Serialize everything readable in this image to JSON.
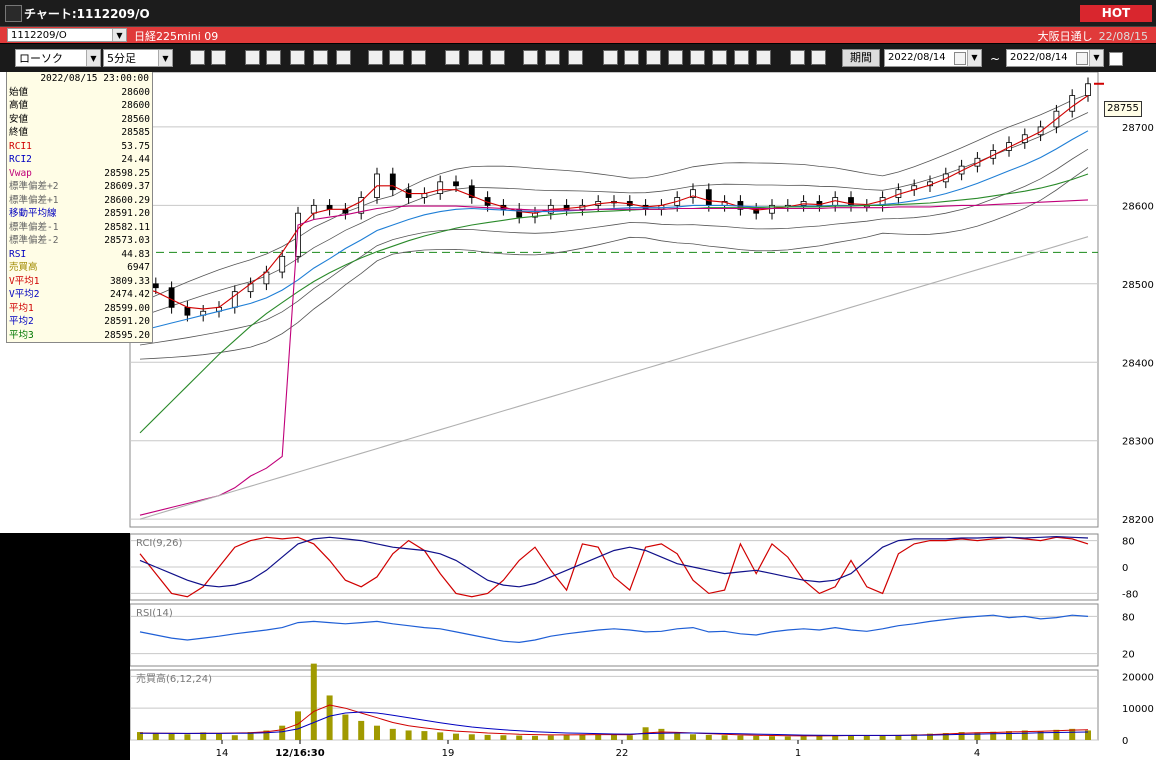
{
  "window": {
    "title": "チャート:1112209/O",
    "hot_label": "HOT"
  },
  "infobar": {
    "symbol": "1112209/O",
    "instrument": "日経225mini 09",
    "session": "大阪日通し",
    "date": "22/08/15"
  },
  "toolbar": {
    "chart_type": "ローソク",
    "interval": "5分足",
    "buttons": [
      "zoom",
      "crosshair",
      "drawing",
      "search",
      "period",
      "rci",
      "info",
      "pen",
      "select",
      "redo",
      "candle",
      "bar",
      "all",
      "settings",
      "tool",
      "color",
      "vwap",
      "ma",
      "bb",
      "vwma",
      "hl",
      "atr",
      "pa",
      "pvt",
      "log",
      "export"
    ],
    "period_label": "期間",
    "date_from": "2022/08/14",
    "date_to": "2022/08/14",
    "range_sep": "~"
  },
  "info_panel": {
    "timestamp": "2022/08/15  23:00:00",
    "rows": [
      {
        "label": "始値",
        "value": "28600",
        "color": "#000000"
      },
      {
        "label": "高値",
        "value": "28600",
        "color": "#000000"
      },
      {
        "label": "安値",
        "value": "28560",
        "color": "#000000"
      },
      {
        "label": "終値",
        "value": "28585",
        "color": "#000000"
      },
      {
        "label": "RCI1",
        "value": "53.75",
        "color": "#d00000"
      },
      {
        "label": "RCI2",
        "value": "24.44",
        "color": "#0000c0"
      },
      {
        "label": "Vwap",
        "value": "28598.25",
        "color": "#c0007a"
      },
      {
        "label": "標準偏差+2",
        "value": "28609.37",
        "color": "#666666"
      },
      {
        "label": "標準偏差+1",
        "value": "28600.29",
        "color": "#666666"
      },
      {
        "label": "移動平均線",
        "value": "28591.20",
        "color": "#0000c0"
      },
      {
        "label": "標準偏差-1",
        "value": "28582.11",
        "color": "#666666"
      },
      {
        "label": "標準偏差-2",
        "value": "28573.03",
        "color": "#666666"
      },
      {
        "label": "RSI",
        "value": "44.83",
        "color": "#0000c0"
      },
      {
        "label": "売買高",
        "value": "6947",
        "color": "#a08a00"
      },
      {
        "label": "V平均1",
        "value": "3809.33",
        "color": "#d00000"
      },
      {
        "label": "V平均2",
        "value": "2474.42",
        "color": "#0000c0"
      },
      {
        "label": "平均1",
        "value": "28599.00",
        "color": "#d00000"
      },
      {
        "label": "平均2",
        "value": "28591.20",
        "color": "#0000c0"
      },
      {
        "label": "平均3",
        "value": "28595.20",
        "color": "#007700"
      }
    ]
  },
  "chart_data": [
    {
      "type": "line",
      "title": "足",
      "yticks": [
        28200,
        28300,
        28400,
        28500,
        28600,
        28700
      ],
      "ylim": [
        28190,
        28770
      ],
      "current_price": "28755",
      "reference_price": 28540,
      "xticks": [
        "14",
        "12/16:30",
        "19",
        "22",
        "1",
        "4"
      ],
      "series": [
        {
          "key": "close",
          "color": "#000000",
          "values": [
            28500,
            28495,
            28470,
            28460,
            28465,
            28470,
            28490,
            28500,
            28515,
            28535,
            28590,
            28600,
            28595,
            28590,
            28610,
            28640,
            28620,
            28610,
            28615,
            28630,
            28625,
            28610,
            28600,
            28595,
            28585,
            28590,
            28600,
            28595,
            28600,
            28605,
            28605,
            28600,
            28595,
            28600,
            28610,
            28620,
            28600,
            28605,
            28595,
            28590,
            28600,
            28600,
            28605,
            28600,
            28610,
            28600,
            28600,
            28610,
            28620,
            28625,
            28630,
            28640,
            28650,
            28660,
            28670,
            28680,
            28690,
            28700,
            28720,
            28740,
            28755
          ]
        },
        {
          "key": "ma_fast",
          "color": "#d00000",
          "values": [
            28495,
            28490,
            28480,
            28470,
            28468,
            28470,
            28485,
            28500,
            28515,
            28540,
            28570,
            28590,
            28595,
            28595,
            28605,
            28625,
            28625,
            28615,
            28615,
            28620,
            28620,
            28612,
            28604,
            28598,
            28592,
            28590,
            28595,
            28596,
            28598,
            28602,
            28604,
            28602,
            28598,
            28600,
            28605,
            28612,
            28606,
            28604,
            28598,
            28594,
            28596,
            28598,
            28602,
            28601,
            28606,
            28602,
            28601,
            28606,
            28614,
            28620,
            28626,
            28634,
            28644,
            28654,
            28664,
            28674,
            28684,
            28694,
            28710,
            28726,
            28740
          ]
        },
        {
          "key": "ma_mid",
          "color": "#1f7fd6",
          "values": [
            28440,
            28445,
            28450,
            28455,
            28460,
            28465,
            28470,
            28475,
            28482,
            28492,
            28505,
            28520,
            28532,
            28545,
            28556,
            28568,
            28575,
            28582,
            28588,
            28592,
            28595,
            28596,
            28595,
            28594,
            28593,
            28592,
            28592,
            28593,
            28594,
            28595,
            28596,
            28597,
            28597,
            28597,
            28598,
            28600,
            28600,
            28600,
            28599,
            28598,
            28598,
            28598,
            28599,
            28599,
            28600,
            28600,
            28600,
            28601,
            28603,
            28606,
            28610,
            28615,
            28621,
            28628,
            28636,
            28644,
            28652,
            28661,
            28672,
            28684,
            28695
          ]
        },
        {
          "key": "ma_slow",
          "color": "#2a8a2a",
          "values": [
            28310,
            28330,
            28350,
            28370,
            28390,
            28410,
            28428,
            28446,
            28462,
            28476,
            28490,
            28503,
            28514,
            28524,
            28533,
            28541,
            28548,
            28555,
            28561,
            28566,
            28571,
            28575,
            28578,
            28581,
            28584,
            28586,
            28588,
            28590,
            28591,
            28592,
            28593,
            28594,
            28595,
            28595,
            28596,
            28596,
            28597,
            28597,
            28597,
            28597,
            28598,
            28598,
            28598,
            28598,
            28599,
            28599,
            28600,
            28600,
            28601,
            28602,
            28603,
            28605,
            28607,
            28609,
            28612,
            28615,
            28618,
            28622,
            28627,
            28633,
            28640
          ]
        },
        {
          "key": "vwap",
          "color": "#c0007a",
          "values": [
            28205,
            28210,
            28215,
            28220,
            28225,
            28230,
            28240,
            28255,
            28265,
            28280,
            28575,
            28582,
            28585,
            28588,
            28592,
            28596,
            28598,
            28599,
            28599,
            28599,
            28599,
            28598,
            28597,
            28596,
            28595,
            28594,
            28594,
            28594,
            28594,
            28595,
            28595,
            28595,
            28595,
            28595,
            28596,
            28596,
            28596,
            28596,
            28596,
            28596,
            28596,
            28596,
            28596,
            28596,
            28597,
            28597,
            28597,
            28597,
            28598,
            28598,
            28598,
            28599,
            28600,
            28600,
            28601,
            28602,
            28603,
            28604,
            28605,
            28606,
            28607
          ]
        },
        {
          "key": "trend",
          "color": "#b0b0b0",
          "values": [
            28200,
            28206,
            28212,
            28218,
            28224,
            28230,
            28236,
            28242,
            28248,
            28254,
            28260,
            28266,
            28272,
            28278,
            28284,
            28290,
            28296,
            28302,
            28308,
            28314,
            28320,
            28326,
            28332,
            28338,
            28344,
            28350,
            28356,
            28362,
            28368,
            28374,
            28380,
            28386,
            28392,
            28398,
            28404,
            28410,
            28416,
            28422,
            28428,
            28434,
            28440,
            28446,
            28452,
            28458,
            28464,
            28470,
            28476,
            28482,
            28488,
            28494,
            28500,
            28506,
            28512,
            28518,
            28524,
            28530,
            28536,
            28542,
            28548,
            28554,
            28560
          ]
        }
      ]
    },
    {
      "type": "line",
      "title": "RCI(9,26)",
      "yticks": [
        80,
        0,
        -80
      ],
      "ylim": [
        -100,
        100
      ],
      "series": [
        {
          "key": "rci_fast",
          "color": "#d00000",
          "values": [
            40,
            -20,
            -80,
            -90,
            -60,
            0,
            60,
            80,
            90,
            85,
            90,
            70,
            20,
            -40,
            -60,
            -30,
            40,
            80,
            50,
            -20,
            -80,
            -90,
            -80,
            -40,
            20,
            60,
            -10,
            -70,
            70,
            60,
            -30,
            -70,
            60,
            70,
            40,
            -40,
            -80,
            -70,
            70,
            -20,
            70,
            30,
            -40,
            -80,
            -60,
            20,
            -60,
            -80,
            40,
            70,
            80,
            80,
            85,
            80,
            85,
            90,
            85,
            80,
            90,
            85,
            70
          ]
        },
        {
          "key": "rci_slow",
          "color": "#10108a",
          "values": [
            20,
            0,
            -20,
            -40,
            -55,
            -60,
            -55,
            -40,
            -10,
            30,
            70,
            85,
            90,
            85,
            80,
            70,
            60,
            55,
            50,
            40,
            20,
            -10,
            -40,
            -55,
            -60,
            -50,
            -30,
            -10,
            10,
            30,
            50,
            60,
            50,
            30,
            10,
            0,
            -10,
            -20,
            -15,
            -10,
            -20,
            -30,
            -40,
            -45,
            -40,
            -20,
            20,
            60,
            80,
            85,
            85,
            85,
            88,
            88,
            90,
            90,
            88,
            90,
            92,
            90,
            88
          ]
        }
      ]
    },
    {
      "type": "line",
      "title": "RSI(14)",
      "yticks": [
        80,
        20
      ],
      "ylim": [
        0,
        100
      ],
      "series": [
        {
          "key": "rsi",
          "color": "#1f5fd6",
          "values": [
            55,
            50,
            45,
            42,
            45,
            48,
            52,
            55,
            58,
            62,
            70,
            72,
            70,
            68,
            70,
            72,
            68,
            65,
            62,
            60,
            55,
            50,
            45,
            40,
            38,
            42,
            48,
            52,
            55,
            58,
            60,
            58,
            55,
            56,
            60,
            62,
            55,
            56,
            52,
            50,
            55,
            58,
            60,
            58,
            62,
            58,
            56,
            60,
            65,
            68,
            72,
            75,
            78,
            80,
            82,
            78,
            80,
            76,
            78,
            82,
            80
          ]
        }
      ]
    },
    {
      "type": "bar",
      "title": "売買高(6,12,24)",
      "yticks": [
        20000,
        10000,
        0
      ],
      "ylim": [
        0,
        22000
      ],
      "series": [
        {
          "key": "volume",
          "color": "#a09a00",
          "values": [
            2500,
            2200,
            2000,
            1800,
            2400,
            2000,
            1500,
            2500,
            3000,
            4500,
            9000,
            24000,
            14000,
            8000,
            6000,
            4500,
            3500,
            3000,
            2800,
            2400,
            2000,
            1800,
            1600,
            1500,
            1400,
            1300,
            1400,
            1500,
            1600,
            1700,
            1600,
            1500,
            4000,
            3500,
            2200,
            1800,
            1600,
            1500,
            1400,
            1300,
            1200,
            1100,
            1200,
            1300,
            1400,
            1500,
            1400,
            1300,
            1500,
            1800,
            2000,
            2200,
            2500,
            2400,
            2600,
            2800,
            3000,
            2800,
            3200,
            3500,
            3000
          ]
        },
        {
          "key": "vma1",
          "color": "#d00000",
          "values": [
            2200,
            2150,
            2100,
            2050,
            2100,
            2150,
            2200,
            2300,
            2600,
            3200,
            5000,
            9000,
            11000,
            10000,
            8500,
            7000,
            5500,
            4500,
            3800,
            3200,
            2800,
            2500,
            2200,
            2000,
            1800,
            1700,
            1600,
            1600,
            1650,
            1700,
            1700,
            1650,
            2200,
            2500,
            2400,
            2200,
            2000,
            1800,
            1600,
            1500,
            1400,
            1350,
            1300,
            1300,
            1350,
            1400,
            1400,
            1400,
            1450,
            1550,
            1700,
            1900,
            2100,
            2250,
            2350,
            2500,
            2650,
            2750,
            2900,
            3100,
            3200
          ]
        },
        {
          "key": "vma2",
          "color": "#0000c0",
          "values": [
            2100,
            2100,
            2080,
            2060,
            2060,
            2080,
            2100,
            2150,
            2300,
            2600,
            3500,
            5500,
            7500,
            8500,
            8800,
            8500,
            7800,
            7000,
            6200,
            5400,
            4700,
            4100,
            3600,
            3200,
            2900,
            2600,
            2400,
            2200,
            2100,
            2000,
            1900,
            1850,
            2000,
            2150,
            2200,
            2200,
            2150,
            2050,
            1950,
            1850,
            1750,
            1650,
            1550,
            1500,
            1450,
            1450,
            1450,
            1450,
            1450,
            1500,
            1550,
            1650,
            1750,
            1850,
            1950,
            2050,
            2150,
            2250,
            2350,
            2450,
            2500
          ]
        }
      ]
    }
  ]
}
